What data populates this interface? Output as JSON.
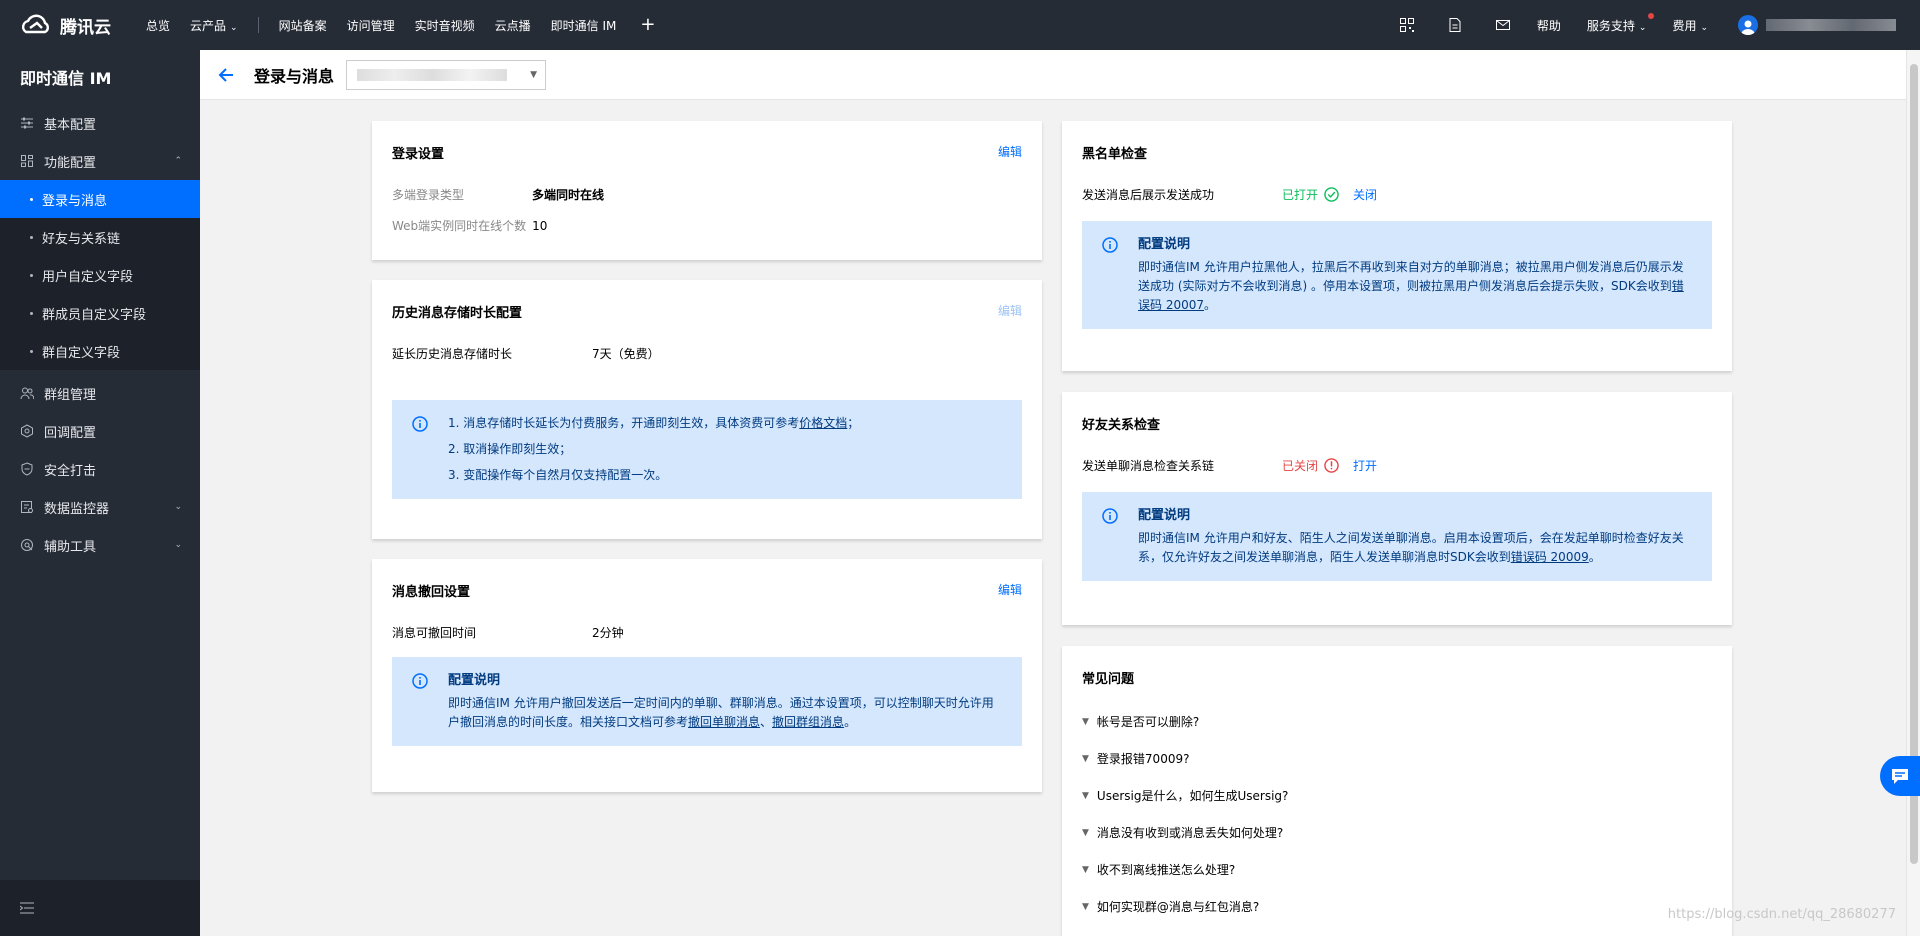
{
  "topbar": {
    "brand": "腾讯云",
    "nav": [
      "总览",
      "云产品",
      "网站备案",
      "访问管理",
      "实时音视频",
      "云点播",
      "即时通信 IM"
    ],
    "plus": "+",
    "right": {
      "help": "帮助",
      "support": "服务支持",
      "billing": "费用"
    }
  },
  "sidebar": {
    "title": "即时通信 IM",
    "items": [
      {
        "label": "基本配置",
        "icon": "sliders-icon"
      },
      {
        "label": "功能配置",
        "icon": "grid-icon",
        "expanded": true
      }
    ],
    "subitems": [
      "登录与消息",
      "好友与关系链",
      "用户自定义字段",
      "群成员自定义字段",
      "群自定义字段"
    ],
    "items2": [
      {
        "label": "群组管理",
        "icon": "group-icon"
      },
      {
        "label": "回调配置",
        "icon": "callback-icon"
      },
      {
        "label": "安全打击",
        "icon": "shield-icon"
      },
      {
        "label": "数据监控器",
        "icon": "monitor-icon",
        "has_chevron": true
      },
      {
        "label": "辅助工具",
        "icon": "tool-icon",
        "has_chevron": true
      }
    ]
  },
  "header": {
    "title": "登录与消息"
  },
  "login_card": {
    "title": "登录设置",
    "edit": "编辑",
    "rows": [
      {
        "label": "多端登录类型",
        "value": "多端同时在线"
      },
      {
        "label": "Web端实例同时在线个数",
        "value": "10"
      }
    ]
  },
  "history_card": {
    "title": "历史消息存储时长配置",
    "edit": "编辑",
    "row": {
      "label": "延长历史消息存储时长",
      "value": "7天（免费）"
    },
    "tips": {
      "l1_pre": "1. 消息存储时长延长为付费服务，开通即刻生效，具体资费可参考",
      "l1_link": "价格文档",
      "l1_post": "；",
      "l2": "2. 取消操作即刻生效；",
      "l3": "3. 变配操作每个自然月仅支持配置一次。"
    }
  },
  "recall_card": {
    "title": "消息撤回设置",
    "edit": "编辑",
    "row": {
      "label": "消息可撤回时间",
      "value": "2分钟"
    },
    "tip_title": "配置说明",
    "tip_pre": "即时通信IM 允许用户撤回发送后一定时间内的单聊、群聊消息。通过本设置项，可以控制聊天时允许用户撤回消息的时间长度。相关接口文档可参考",
    "link1": "撤回单聊消息",
    "sep": "、",
    "link2": "撤回群组消息",
    "tip_post": "。"
  },
  "blacklist_card": {
    "title": "黑名单检查",
    "row_label": "发送消息后展示发送成功",
    "status": "已打开",
    "action": "关闭",
    "tip_title": "配置说明",
    "tip_pre": "即时通信IM 允许用户拉黑他人，拉黑后不再收到来自对方的单聊消息；被拉黑用户侧发消息后仍展示发送成功 (实际对方不会收到消息) 。停用本设置项，则被拉黑用户侧发消息后会提示失败，SDK会收到",
    "link": "错误码 20007",
    "tip_post": "。"
  },
  "friend_card": {
    "title": "好友关系检查",
    "row_label": "发送单聊消息检查关系链",
    "status": "已关闭",
    "action": "打开",
    "tip_title": "配置说明",
    "tip_pre": "即时通信IM 允许用户和好友、陌生人之间发送单聊消息。启用本设置项后，会在发起单聊时检查好友关系，仅允许好友之间发送单聊消息，陌生人发送单聊消息时SDK会收到",
    "link": "错误码 20009",
    "tip_post": "。"
  },
  "faq_card": {
    "title": "常见问题",
    "items": [
      "帐号是否可以删除?",
      "登录报错70009?",
      "Usersig是什么，如何生成Usersig?",
      "消息没有收到或消息丢失如何处理?",
      "收不到离线推送怎么处理?",
      "如何实现群@消息与红包消息?"
    ]
  },
  "watermark": "https://blog.csdn.net/qq_28680277",
  "colors": {
    "accent": "#006eff",
    "sidebar": "#262c36",
    "tip_bg": "#d5e7fd",
    "on": "#0abf5b",
    "off": "#e54545"
  }
}
